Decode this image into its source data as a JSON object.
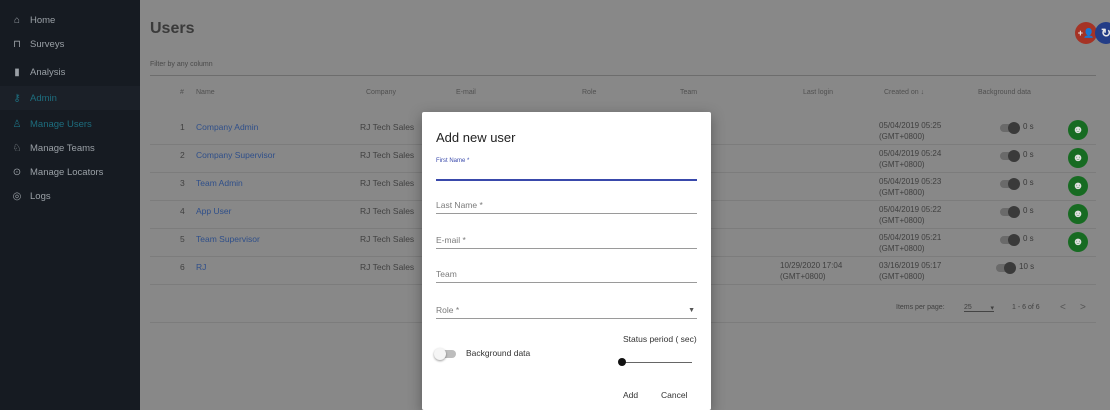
{
  "sidebar": {
    "items": [
      {
        "label": "Home",
        "icon": "home-icon",
        "glyph": "⌂"
      },
      {
        "label": "Surveys",
        "icon": "surveys-icon",
        "glyph": "⊓"
      },
      {
        "label": "Analysis",
        "icon": "analysis-icon",
        "glyph": "▮"
      },
      {
        "label": "Admin",
        "icon": "admin-key-icon",
        "glyph": "⚷"
      },
      {
        "label": "Manage Users",
        "icon": "users-icon",
        "glyph": "♙"
      },
      {
        "label": "Manage Teams",
        "icon": "teams-icon",
        "glyph": "♘"
      },
      {
        "label": "Manage Locators",
        "icon": "locator-icon",
        "glyph": "⊙"
      },
      {
        "label": "Logs",
        "icon": "logs-icon",
        "glyph": "◎"
      }
    ]
  },
  "header": {
    "title": "Users",
    "add_user_icon": "+👤",
    "refresh_icon": "↻"
  },
  "filter": {
    "placeholder": "Filter by any column"
  },
  "table": {
    "columns": [
      "#",
      "Name",
      "Company",
      "E-mail",
      "Role",
      "Team",
      "Last login",
      "Created on ↓",
      "Background data"
    ],
    "rows": [
      {
        "num": "1",
        "name": "Company Admin",
        "company": "RJ Tech Sales",
        "last_login_1": "",
        "last_login_2": "",
        "created_1": "05/04/2019 05:25",
        "created_2": "(GMT+0800)",
        "bg": "0 s",
        "action": true
      },
      {
        "num": "2",
        "name": "Company Supervisor",
        "company": "RJ Tech Sales",
        "last_login_1": "",
        "last_login_2": "",
        "created_1": "05/04/2019 05:24",
        "created_2": "(GMT+0800)",
        "bg": "0 s",
        "action": true
      },
      {
        "num": "3",
        "name": "Team Admin",
        "company": "RJ Tech Sales",
        "last_login_1": "",
        "last_login_2": "",
        "created_1": "05/04/2019 05:23",
        "created_2": "(GMT+0800)",
        "bg": "0 s",
        "action": true
      },
      {
        "num": "4",
        "name": "App User",
        "company": "RJ Tech Sales",
        "last_login_1": "",
        "last_login_2": "",
        "created_1": "05/04/2019 05:22",
        "created_2": "(GMT+0800)",
        "bg": "0 s",
        "action": true
      },
      {
        "num": "5",
        "name": "Team Supervisor",
        "company": "RJ Tech Sales",
        "last_login_1": "",
        "last_login_2": "",
        "created_1": "05/04/2019 05:21",
        "created_2": "(GMT+0800)",
        "bg": "0 s",
        "action": true
      },
      {
        "num": "6",
        "name": "RJ",
        "company": "RJ Tech Sales",
        "last_login_1": "10/29/2020 17:04",
        "last_login_2": "(GMT+0800)",
        "created_1": "03/16/2019 05:17",
        "created_2": "(GMT+0800)",
        "bg": "10 s",
        "action": false
      }
    ],
    "action_icon": "user-circle-icon",
    "action_glyph": "☻"
  },
  "footer": {
    "items_per_page_label": "Items per page:",
    "items_per_page_value": "25",
    "range": "1 - 6 of 6",
    "prev": "<",
    "next": ">"
  },
  "dialog": {
    "title": "Add new user",
    "first_name_label": "First Name *",
    "last_name_label": "Last Name *",
    "email_label": "E-mail *",
    "team_label": "Team",
    "role_label": "Role *",
    "background_data_label": "Background data",
    "status_period_label": "Status period ( sec)",
    "add_label": "Add",
    "cancel_label": "Cancel"
  },
  "colors": {
    "sidebar_bg": "#161b22",
    "accent_teal": "#1d6d7e",
    "focus_blue": "#3949ab",
    "fab_red": "#a53325",
    "fab_blue": "#233d87",
    "action_green": "#176b22"
  }
}
